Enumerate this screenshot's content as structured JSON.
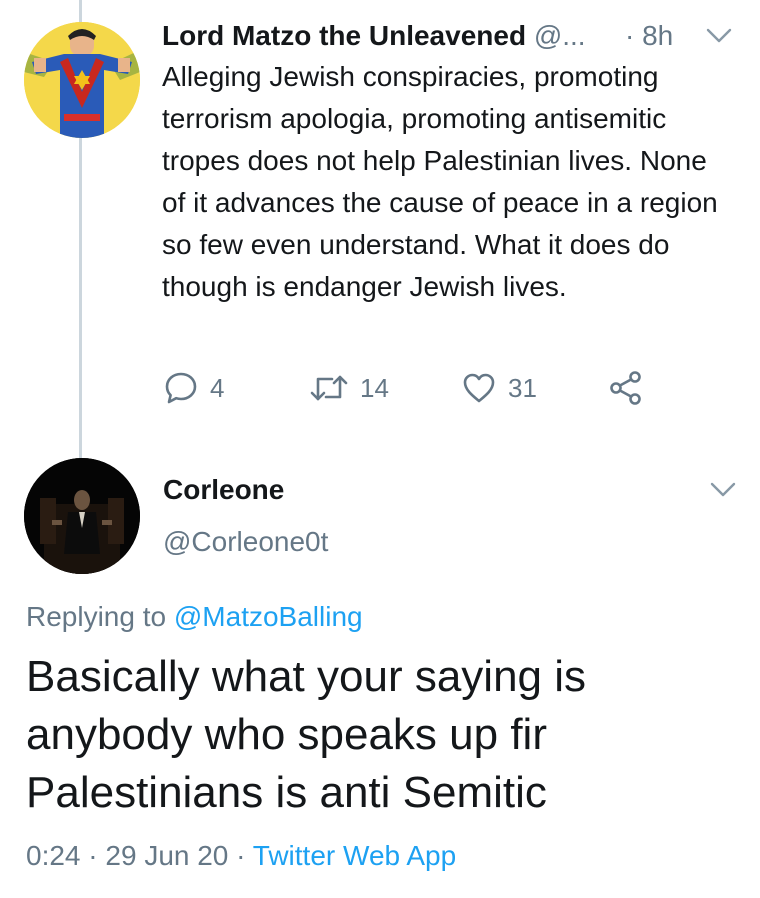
{
  "tweet1": {
    "name": "Lord Matzo the Unleavened",
    "handle": "@...",
    "time": "· 8h",
    "text": "Alleging Jewish conspiracies, promoting terrorism apologia, promoting antisemitic tropes does not help Palestinian lives. None of it advances the cause of peace in a region so few even understand. What it does do though is endanger Jewish lives.",
    "replies": "4",
    "retweets": "14",
    "likes": "31"
  },
  "tweet2": {
    "name": "Corleone",
    "handle": "@Corleone0t",
    "replying_prefix": "Replying to",
    "replying_to": "@MatzoBalling",
    "text": "Basically what your saying is anybody who speaks up fir Palestinians is anti Semitic",
    "time": "0:24",
    "date": "29 Jun 20",
    "source": "Twitter Web App"
  },
  "colors": {
    "text": "#14171a",
    "secondary": "#657786",
    "link": "#1da1f2",
    "thread_line": "#ccd6dd"
  },
  "icons": [
    "reply-icon",
    "retweet-icon",
    "like-icon",
    "share-icon",
    "chevron-down-icon"
  ]
}
